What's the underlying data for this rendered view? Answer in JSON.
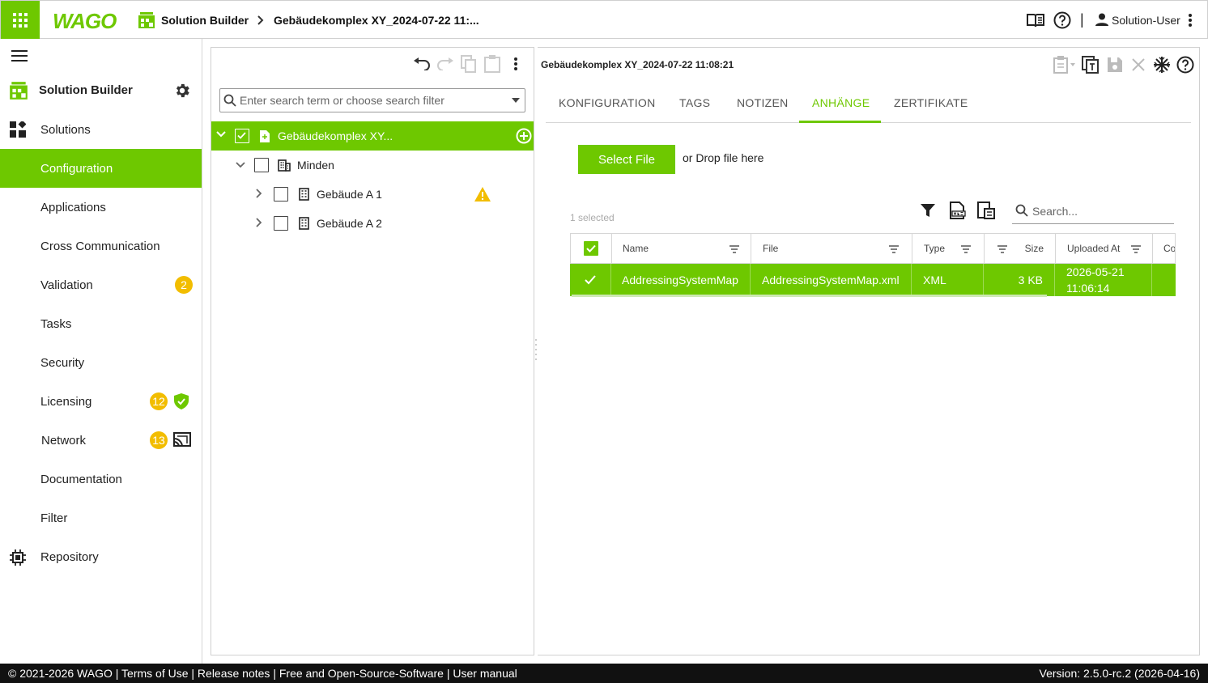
{
  "header": {
    "logo_text": "WAGO",
    "app_name": "Solution Builder",
    "breadcrumb_current": "Gebäudekomplex XY_2024-07-22 11:...",
    "separator": "|",
    "user_name": "Solution-User"
  },
  "sidebar": {
    "title": "Solution Builder",
    "items": [
      {
        "label": "Solutions"
      },
      {
        "label": "Configuration"
      },
      {
        "label": "Applications"
      },
      {
        "label": "Cross Communication"
      },
      {
        "label": "Validation",
        "badge": "2"
      },
      {
        "label": "Tasks"
      },
      {
        "label": "Security"
      },
      {
        "label": "Licensing",
        "badge": "12"
      },
      {
        "label": "Network",
        "badge": "13"
      },
      {
        "label": "Documentation"
      },
      {
        "label": "Filter"
      },
      {
        "label": "Repository"
      }
    ]
  },
  "tree": {
    "search_placeholder": "Enter search term or choose search filter",
    "nodes": [
      {
        "label": "Gebäudekomplex XY..."
      },
      {
        "label": "Minden"
      },
      {
        "label": "Gebäude A 1"
      },
      {
        "label": "Gebäude A 2"
      }
    ]
  },
  "detail": {
    "title": "Gebäudekomplex XY_2024-07-22 11:08:21",
    "tabs": [
      "KONFIGURATION",
      "TAGS",
      "NOTIZEN",
      "ANHÄNGE",
      "ZERTIFIKATE"
    ],
    "active_tab": "ANHÄNGE",
    "select_file_label": "Select File",
    "drop_hint": "or Drop file here",
    "selected_count": "1 selected",
    "grid_search_placeholder": "Search...",
    "columns": [
      "Name",
      "File",
      "Type",
      "Size",
      "Uploaded At",
      "Co"
    ],
    "rows": [
      {
        "name": "AddressingSystemMap",
        "file": "AddressingSystemMap.xml",
        "type": "XML",
        "size": "3 KB",
        "uploaded_date": "2026-05-21",
        "uploaded_time": "11:06:14"
      }
    ]
  },
  "footer": {
    "copyright": "© 2021-2026 WAGO",
    "links": [
      "Terms of Use",
      "Release notes",
      "Free and Open-Source-Software",
      "User manual"
    ],
    "version": "Version: 2.5.0-rc.2 (2026-04-16)"
  },
  "colors": {
    "accent": "#6ec800",
    "badge": "#f2bd00",
    "footer_bg": "#111111"
  }
}
